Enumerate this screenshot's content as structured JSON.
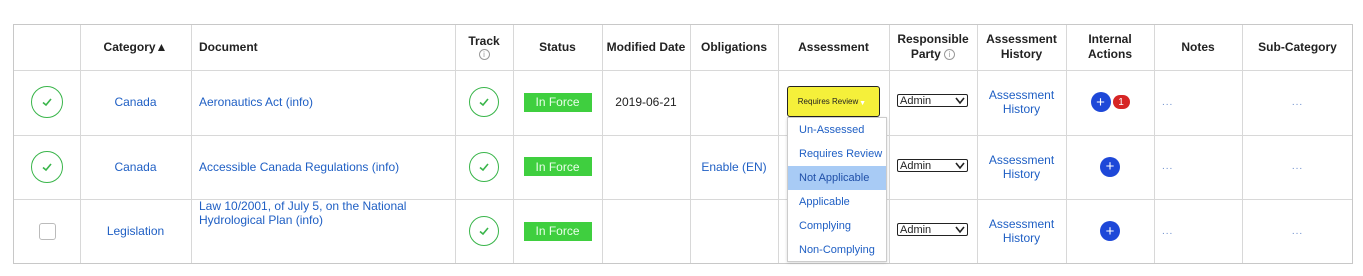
{
  "headers": {
    "category": "Category▲",
    "document": "Document",
    "track": "Track",
    "status": "Status",
    "modified": "Modified Date",
    "obligations": "Obligations",
    "assessment": "Assessment",
    "responsible_1": "Responsible",
    "responsible_2": "Party",
    "history_1": "Assessment",
    "history_2": "History",
    "internal_1": "Internal",
    "internal_2": "Actions",
    "notes": "Notes",
    "subcategory": "Sub-Category",
    "info_glyph": "i"
  },
  "rows": [
    {
      "checked": true,
      "category": "Canada",
      "document": "Aeronautics Act (info)",
      "status": "In Force",
      "modified": "2019-06-21",
      "obligations": "",
      "assessment": "Requires Review",
      "responsible": "Admin",
      "history_1": "Assessment",
      "history_2": "History",
      "actions_badge": "1",
      "notes": "...",
      "subcategory": "..."
    },
    {
      "checked": true,
      "category": "Canada",
      "document": "Accessible Canada Regulations (info)",
      "status": "In Force",
      "modified": "",
      "obligations": "Enable (EN)",
      "assessment": "",
      "responsible": "Admin",
      "history_1": "Assessment",
      "history_2": "History",
      "actions_badge": "",
      "notes": "...",
      "subcategory": "..."
    },
    {
      "checked": false,
      "category": "Legislation",
      "document_1": "Law 10/2001, of July 5, on the National",
      "document_2": "Hydrological Plan (info)",
      "status": "In Force",
      "modified": "",
      "obligations": "",
      "assessment": "",
      "responsible": "Admin",
      "history_1": "Assessment",
      "history_2": "History",
      "actions_badge": "",
      "notes": "...",
      "subcategory": "..."
    }
  ],
  "assessment_dropdown": {
    "options": [
      "Un-Assessed",
      "Requires Review",
      "Not Applicable",
      "Applicable",
      "Complying",
      "Non-Complying"
    ],
    "highlighted": "Not Applicable"
  },
  "plus_glyph": "+",
  "colors": {
    "link": "#1f5fc4",
    "status_green": "#3fcf3f",
    "assessment_yellow": "#f5f03a",
    "action_blue": "#1e48d8",
    "badge_red": "#d62525",
    "highlight_blue": "#a8cbf5"
  }
}
